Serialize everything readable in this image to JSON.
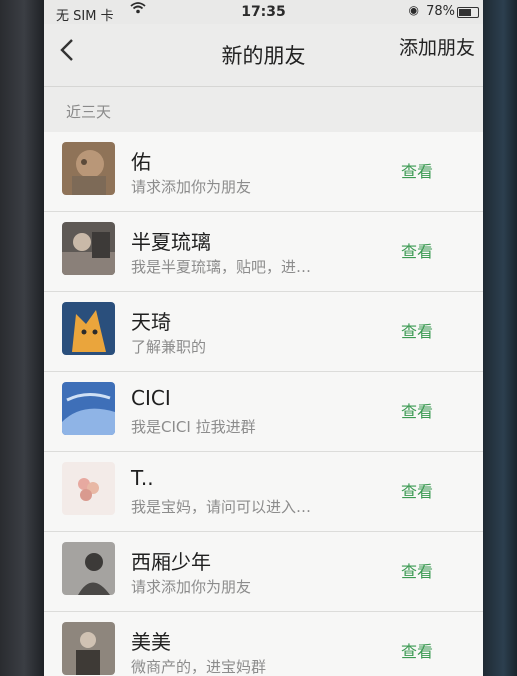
{
  "status_bar": {
    "carrier": "无 SIM 卡",
    "time": "17:35",
    "battery": "78%",
    "battery_level": 0.78
  },
  "nav": {
    "title": "新的朋友",
    "action": "添加朋友"
  },
  "section_label": "近三天",
  "requests": [
    {
      "name": "佑",
      "message": "请求添加你为朋友",
      "action": "查看",
      "avatar_color": "#9a7a5e"
    },
    {
      "name": "半夏琉璃",
      "message": "我是半夏琉璃，贴吧，进…",
      "action": "查看",
      "avatar_color": "#6b6660"
    },
    {
      "name": "天琦",
      "message": "了解兼职的",
      "action": "查看",
      "avatar_color": "#e7a543"
    },
    {
      "name": "CICI",
      "message": "我是CICI 拉我进群",
      "action": "查看",
      "avatar_color": "#4f7ec2"
    },
    {
      "name": "T..",
      "message": "我是宝妈，请问可以进入…",
      "action": "查看",
      "avatar_color": "#f0e3df"
    },
    {
      "name": "西厢少年",
      "message": "请求添加你为朋友",
      "action": "查看",
      "avatar_color": "#8d8b88"
    },
    {
      "name": "美美",
      "message": "微商产的，进宝妈群",
      "action": "查看",
      "avatar_color": "#7a726a"
    }
  ]
}
